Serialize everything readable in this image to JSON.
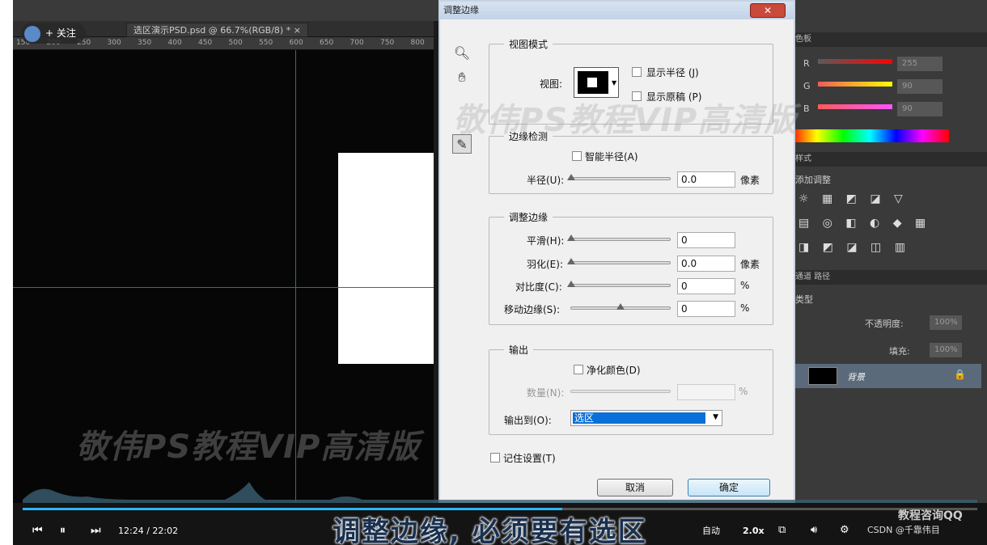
{
  "follow": {
    "label": "+ 关注"
  },
  "document": {
    "tab_label": "选区演示PSD.psd @ 66.7%(RGB/8) *",
    "ruler_ticks": [
      "150",
      "200",
      "250",
      "300",
      "350",
      "400",
      "450",
      "500",
      "550",
      "600",
      "650",
      "700",
      "750",
      "800"
    ]
  },
  "watermarks": {
    "dialog_overlay": "敬伟PS教程VIP高清版",
    "canvas": "敬伟PS教程VIP高清版"
  },
  "dialog": {
    "title": "调整边缘",
    "view_mode": {
      "legend": "视图模式",
      "view_label": "视图:",
      "show_radius": "显示半径 (J)",
      "show_original": "显示原稿 (P)"
    },
    "edge_detection": {
      "legend": "边缘检测",
      "smart_radius": "智能半径(A)",
      "radius_label": "半径(U):",
      "radius_value": "0.0",
      "radius_unit": "像素"
    },
    "adjust_edge": {
      "legend": "调整边缘",
      "smooth": {
        "label": "平滑(H):",
        "value": "0"
      },
      "feather": {
        "label": "羽化(E):",
        "value": "0.0",
        "unit": "像素"
      },
      "contrast": {
        "label": "对比度(C):",
        "value": "0",
        "unit": "%"
      },
      "shift": {
        "label": "移动边缘(S):",
        "value": "0",
        "unit": "%"
      }
    },
    "output": {
      "legend": "输出",
      "decontaminate": "净化颜色(D)",
      "amount_label": "数量(N):",
      "amount_unit": "%",
      "output_to_label": "输出到(O):",
      "output_to_value": "选区"
    },
    "remember": "记住设置(T)",
    "cancel": "取消",
    "ok": "确定"
  },
  "right_panel": {
    "color_tab": "色板",
    "r_label": "R",
    "g_label": "G",
    "b_label": "B",
    "r_value": "255",
    "g_value": "90",
    "b_value": "90",
    "styles_tab": "样式",
    "adjustments_label": "添加调整",
    "channels_tab": "通道",
    "paths_tab": "路径",
    "kind_label": "类型",
    "opacity_label": "不透明度:",
    "opacity_value": "100%",
    "fill_label": "填充:",
    "fill_value": "100%",
    "layer_name": "背景"
  },
  "player": {
    "time": "12:24 / 22:02",
    "subtitle": "调整边缘, 必须要有选区",
    "auto": "自动",
    "speed": "2.0x",
    "brand": "教程咨询QQ",
    "credit": "CSDN @千靠伟目",
    "progress": 0.565
  }
}
